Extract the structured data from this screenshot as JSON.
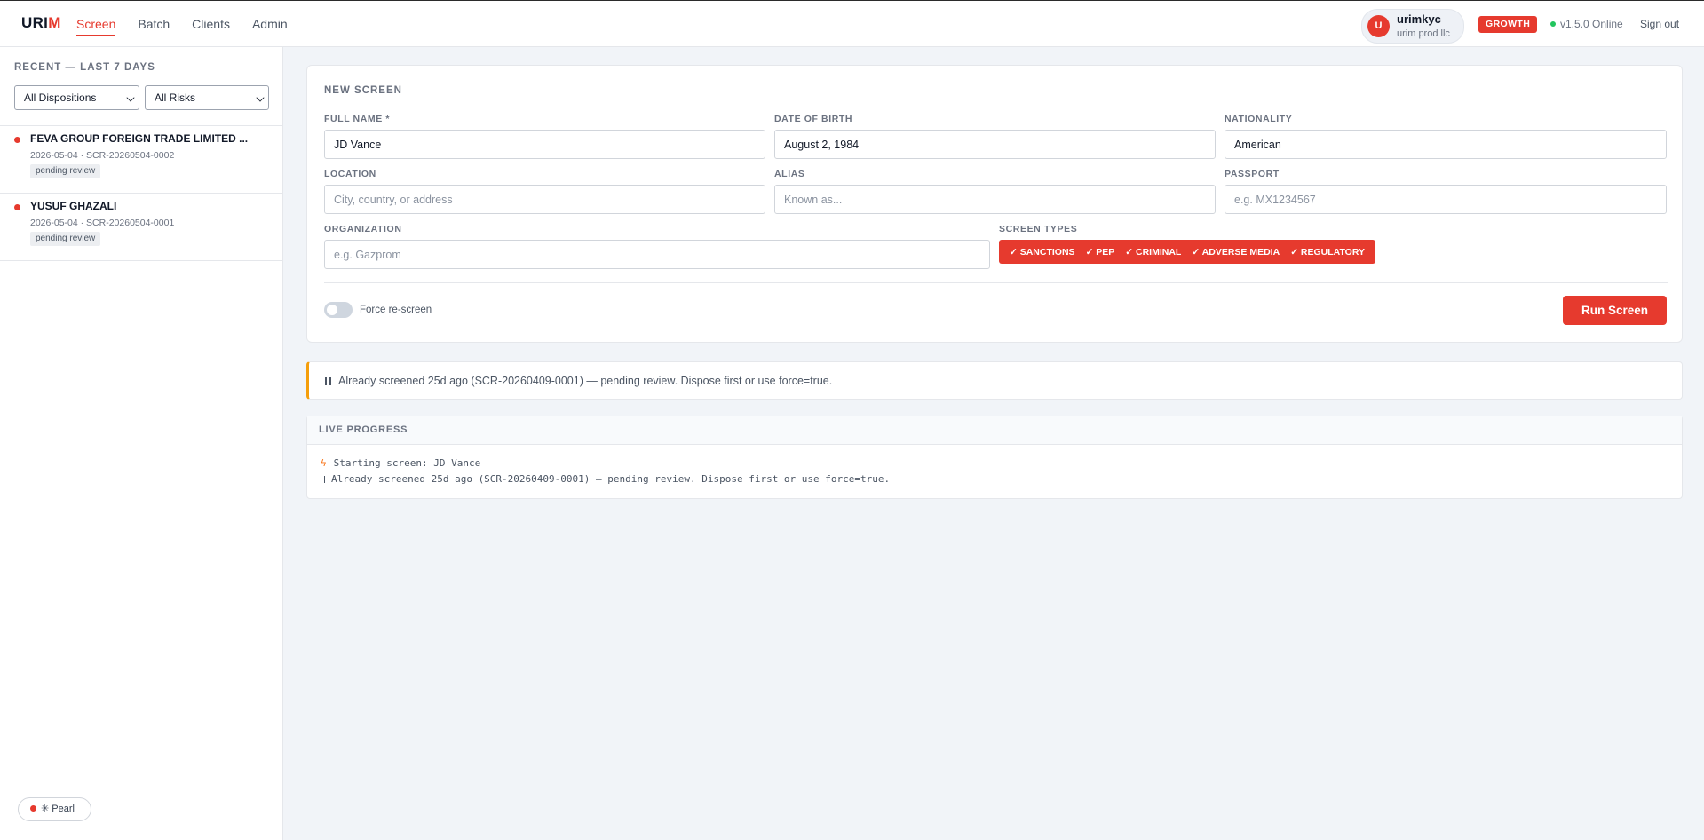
{
  "app": {
    "logo_main": "URI",
    "logo_accent": "M"
  },
  "nav": {
    "items": [
      {
        "label": "Screen",
        "active": true
      },
      {
        "label": "Batch"
      },
      {
        "label": "Clients"
      },
      {
        "label": "Admin"
      }
    ]
  },
  "user": {
    "initial": "U",
    "name": "urimkyc",
    "org": "urim prod llc"
  },
  "plan_badge": "GROWTH",
  "status": "v1.5.0 Online",
  "signout": "Sign out",
  "sidebar": {
    "title": "RECENT — LAST 7 DAYS",
    "filter_disposition": "All Dispositions",
    "filter_risk": "All Risks",
    "items": [
      {
        "name": "FEVA GROUP FOREIGN TRADE LIMITED ...",
        "meta": "2026-05-04 · SCR-20260504-0002",
        "badge": "pending review"
      },
      {
        "name": "YUSUF GHAZALI",
        "meta": "2026-05-04 · SCR-20260504-0001",
        "badge": "pending review"
      }
    ],
    "pearl_label": "✳ Pearl"
  },
  "form": {
    "title": "NEW SCREEN",
    "full_name": {
      "label": "FULL NAME *",
      "value": "JD Vance"
    },
    "dob": {
      "label": "DATE OF BIRTH",
      "value": "August 2, 1984"
    },
    "nationality": {
      "label": "NATIONALITY",
      "value": "American"
    },
    "location": {
      "label": "LOCATION",
      "placeholder": "City, country, or address"
    },
    "alias": {
      "label": "ALIAS",
      "placeholder": "Known as..."
    },
    "passport": {
      "label": "PASSPORT",
      "placeholder": "e.g. MX1234567"
    },
    "organization": {
      "label": "ORGANIZATION",
      "placeholder": "e.g. Gazprom"
    },
    "screen_types_label": "SCREEN TYPES",
    "screen_types": [
      "✓ SANCTIONS",
      "✓ PEP",
      "✓ CRIMINAL",
      "✓ ADVERSE MEDIA",
      "✓ REGULATORY"
    ],
    "force_label": "Force re-screen",
    "force_on": false,
    "run_label": "Run Screen"
  },
  "alert": {
    "text": "Already screened 25d ago (SCR-20260409-0001) — pending review. Dispose first or use force=true."
  },
  "progress": {
    "title": "LIVE PROGRESS",
    "lines": [
      "Starting screen: JD Vance",
      "Already screened 25d ago (SCR-20260409-0001) — pending review. Dispose first or use force=true."
    ]
  },
  "colors": {
    "accent": "#e63a2e",
    "online": "#22c55e",
    "warning": "#f59e0b"
  }
}
